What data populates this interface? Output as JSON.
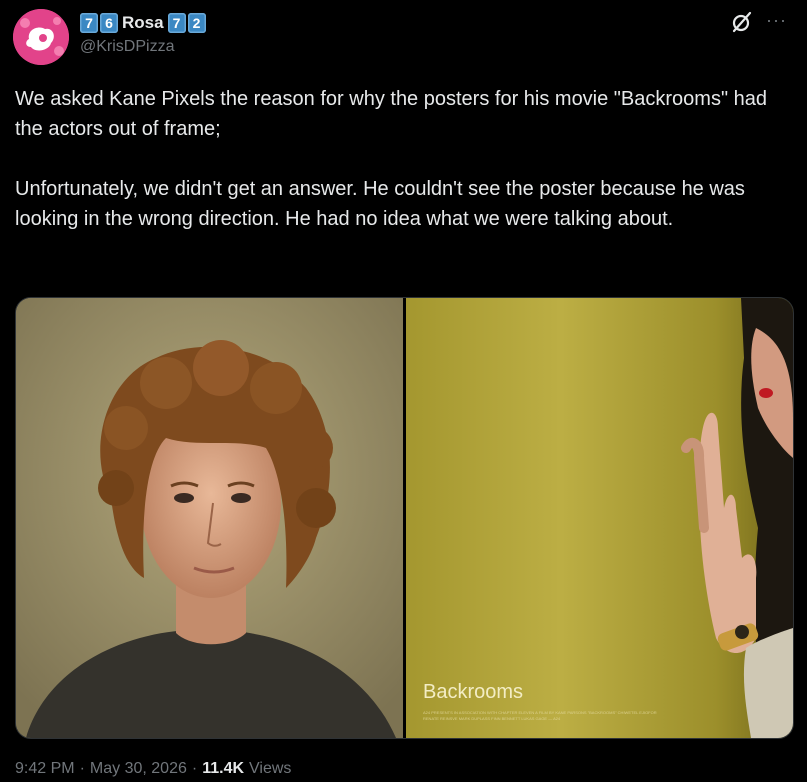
{
  "author": {
    "keycap_before": [
      "7",
      "6"
    ],
    "name": "Rosa",
    "keycap_after": [
      "7",
      "2"
    ],
    "handle": "@KrisDPizza",
    "avatar_icon": "pink-splash-avatar"
  },
  "actions": {
    "grok_icon": "grok-slash-icon",
    "more_label": "···"
  },
  "tweet": {
    "paragraph1": "We asked Kane Pixels the reason for why the posters for his movie \"Backrooms\" had the actors out of frame;",
    "paragraph2": "Unfortunately, we didn't get an answer. He couldn't see the poster because he was looking in the wrong direction. He had no idea what we were talking about."
  },
  "media": {
    "poster_title": "Backrooms",
    "poster_credits": "A24 PRESENTS IN ASSOCIATION WITH CHAPTER ELEVEN A FILM BY KANE PARSONS \"BACKROOMS\" CHIWETEL EJIOFOR RENATE REINSVE MARK DUPLASS FINN BENNETT LUKAS GAGE — A24"
  },
  "footer": {
    "time": "9:42 PM",
    "sep1": "·",
    "date": "May 30, 2026",
    "sep2": "·",
    "views_count": "11.4K",
    "views_label": "Views"
  },
  "colors": {
    "background": "#000000",
    "text_primary": "#e7e9ea",
    "text_secondary": "#71767b",
    "keycap_blue": "#3b88c3",
    "poster_yellow": "#b6a83f"
  }
}
